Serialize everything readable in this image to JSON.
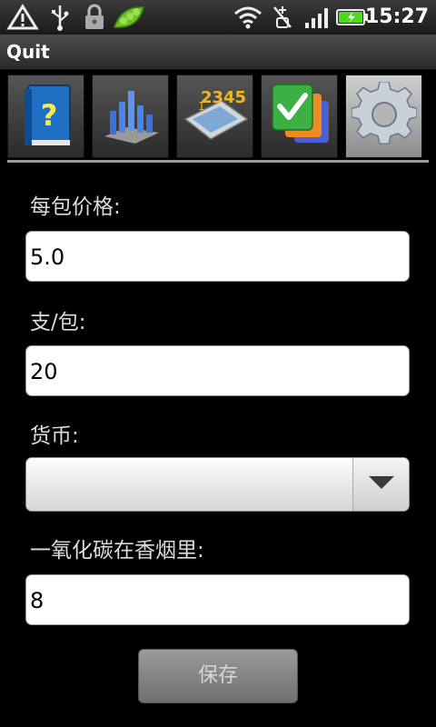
{
  "status_bar": {
    "time": "15:27",
    "icons": [
      "alert-icon",
      "usb-icon",
      "lock-icon",
      "pea-pod-icon",
      "wifi-icon",
      "vibrate-icon",
      "signal-icon",
      "battery-icon"
    ]
  },
  "title_bar": {
    "title": "Quit"
  },
  "tabs": [
    {
      "icon": "help-book-icon",
      "selected": false
    },
    {
      "icon": "bar-chart-icon",
      "selected": false
    },
    {
      "icon": "calculator-icon",
      "selected": false
    },
    {
      "icon": "checklist-icon",
      "selected": false
    },
    {
      "icon": "gear-icon",
      "selected": true
    }
  ],
  "form": {
    "price_label": "每包价格:",
    "price_value": "5.0",
    "per_pack_label": "支/包:",
    "per_pack_value": "20",
    "currency_label": "货币:",
    "currency_value": "",
    "co_label": "一氧化碳在香烟里:",
    "co_value": "8",
    "save_label": "保存"
  },
  "colors": {
    "background": "#000000",
    "tab_selected": "#b5b5b5",
    "tab_line": "#9a9a9a",
    "button": "#8a8a8a",
    "battery": "#4fd81e"
  }
}
